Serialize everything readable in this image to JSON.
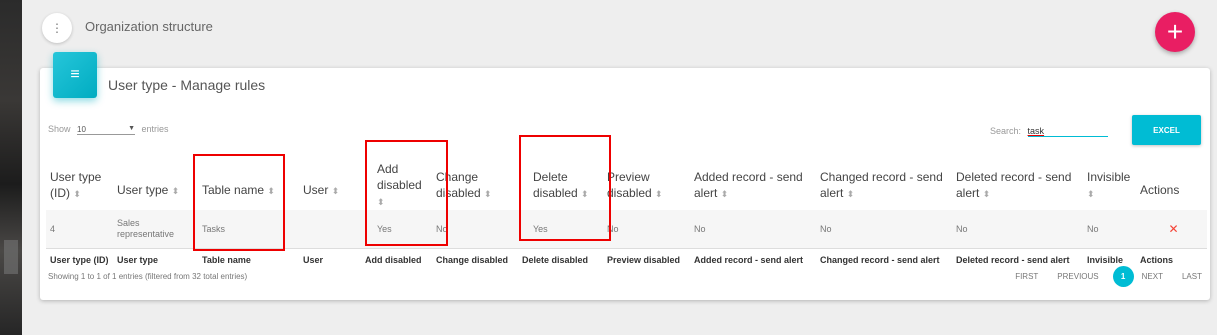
{
  "header": {
    "title": "Organization structure",
    "menu_icon": "⋮",
    "add_icon": "+"
  },
  "card": {
    "title": "User type - Manage rules",
    "icon": "≡"
  },
  "controls": {
    "show_label": "Show",
    "entries_value": "10",
    "entries_label": "entries",
    "search_label": "Search:",
    "search_value": "task",
    "excel_label": "EXCEL"
  },
  "table": {
    "headers": [
      {
        "line1": "User type",
        "line2": "(ID)"
      },
      {
        "line1": "User type",
        "line2": ""
      },
      {
        "line1": "Table name",
        "line2": ""
      },
      {
        "line1": "User",
        "line2": ""
      },
      {
        "line1": "Add",
        "line2": "disabled"
      },
      {
        "line1": "Change",
        "line2": "disabled"
      },
      {
        "line1": "Delete",
        "line2": "disabled"
      },
      {
        "line1": "Preview",
        "line2": "disabled"
      },
      {
        "line1": "Added record - send",
        "line2": "alert"
      },
      {
        "line1": "Changed record - send",
        "line2": "alert"
      },
      {
        "line1": "Deleted record - send",
        "line2": "alert"
      },
      {
        "line1": "Invisible",
        "line2": ""
      },
      {
        "line1": "Actions",
        "line2": ""
      }
    ],
    "rows": [
      {
        "id": "4",
        "user_type_line1": "Sales",
        "user_type_line2": "representative",
        "table_name": "Tasks",
        "user": "",
        "add_disabled": "Yes",
        "change_disabled": "No",
        "delete_disabled": "Yes",
        "preview_disabled": "No",
        "added_alert": "No",
        "changed_alert": "No",
        "deleted_alert": "No",
        "invisible": "No",
        "action_icon": "✕"
      }
    ],
    "footer": [
      "User type (ID)",
      "User type",
      "Table name",
      "User",
      "Add disabled",
      "Change disabled",
      "Delete disabled",
      "Preview disabled",
      "Added record - send alert",
      "Changed record - send alert",
      "Deleted record - send alert",
      "Invisible",
      "Actions"
    ]
  },
  "info": "Showing 1 to 1 of 1 entries (filtered from 32 total entries)",
  "pagination": {
    "first": "FIRST",
    "previous": "PREVIOUS",
    "current": "1",
    "next": "NEXT",
    "last": "LAST"
  },
  "colors": {
    "accent": "#00bcd4",
    "fab": "#e91e63",
    "highlight": "#e00000"
  }
}
